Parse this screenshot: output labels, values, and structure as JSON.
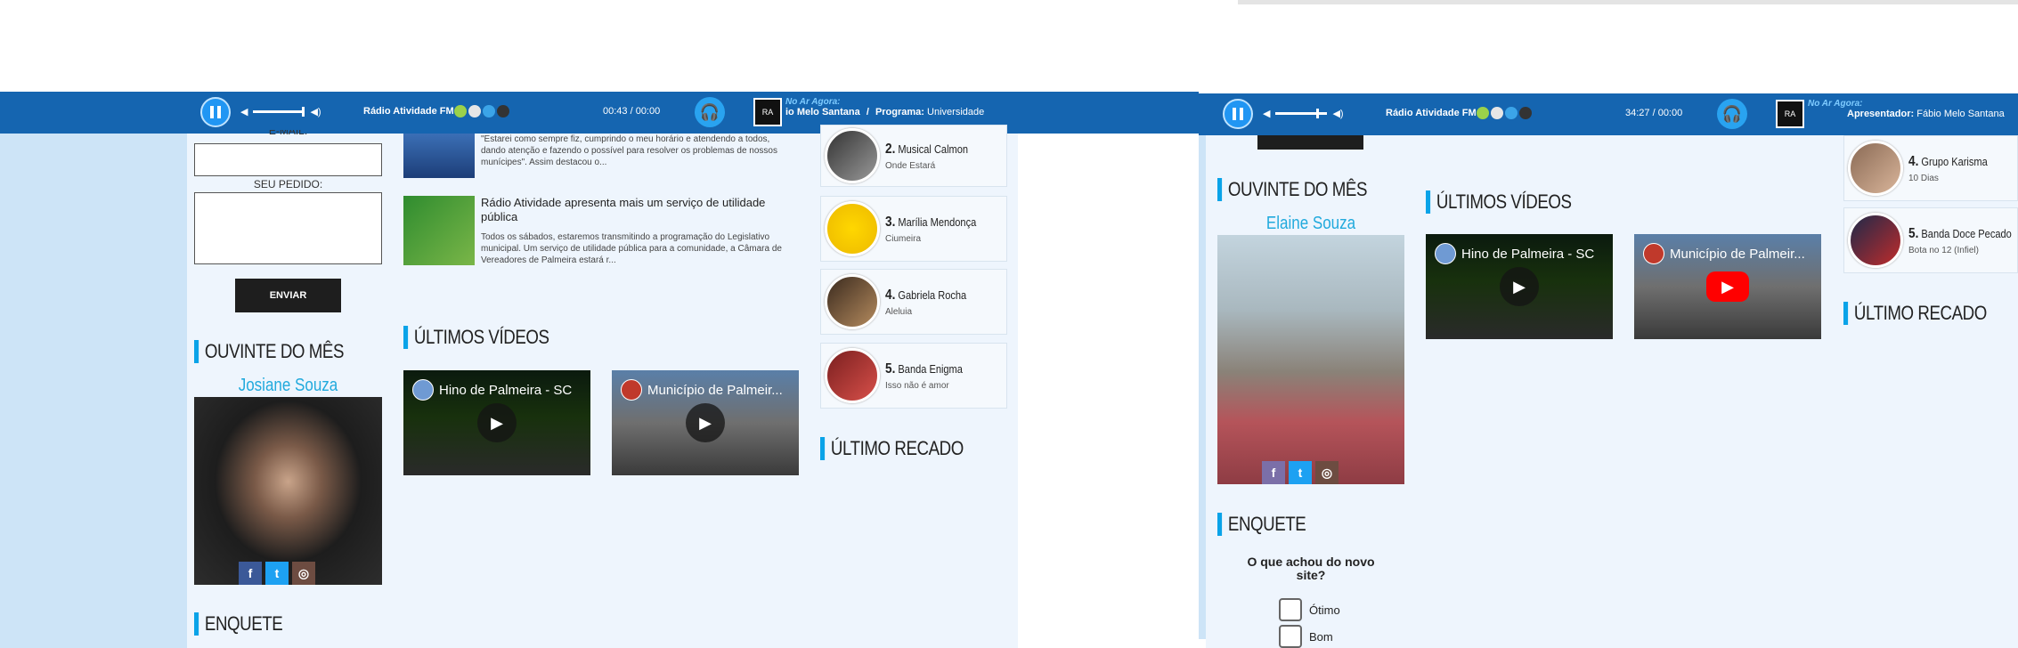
{
  "left": {
    "player": {
      "station": "Rádio Atividade FM",
      "time": "00:43 / 00:00",
      "now_on_air_label": "No Ar Agora:",
      "presenter_fragment": "io Melo Santana",
      "separator": "/",
      "program_label": "Programa:",
      "program_value": "Universidade"
    },
    "form": {
      "email_label": "E-MAIL:",
      "request_label": "SEU PEDIDO:",
      "send_button": "ENVIAR"
    },
    "listener": {
      "section_title": "OUVINTE DO MÊS",
      "name": "Josiane Souza"
    },
    "poll": {
      "section_title": "ENQUETE"
    },
    "news": [
      {
        "title": "",
        "text": "\"Estarei como sempre fiz, cumprindo o meu horário e atendendo a todos, dando atenção e fazendo o possível para resolver os problemas de nossos munícipes\". Assim destacou o..."
      },
      {
        "title": "Rádio Atividade apresenta mais um serviço de utilidade pública",
        "text": "Todos os sábados, estaremos transmitindo a programação do Legislativo municipal. Um serviço de utilidade pública para a comunidade, a Câmara de Vereadores de Palmeira estará r..."
      }
    ],
    "videos": {
      "section_title": "ÚLTIMOS VÍDEOS",
      "items": [
        "Hino de Palmeira - SC",
        "Município de Palmeir..."
      ]
    },
    "ranking": [
      {
        "pos": "2.",
        "artist": "Musical Calmon",
        "song": "Onde Estará"
      },
      {
        "pos": "3.",
        "artist": "Marília Mendonça",
        "song": "Ciumeira"
      },
      {
        "pos": "4.",
        "artist": "Gabriela Rocha",
        "song": "Aleluia"
      },
      {
        "pos": "5.",
        "artist": "Banda Enigma",
        "song": "Isso não é amor"
      }
    ],
    "messages": {
      "section_title": "ÚLTIMO RECADO"
    }
  },
  "right": {
    "player": {
      "station": "Rádio Atividade FM",
      "time": "34:27 / 00:00",
      "now_on_air_label": "No Ar Agora:",
      "presenter_label": "Apresentador:",
      "presenter_value": "Fábio Melo Santana"
    },
    "listener": {
      "section_title": "OUVINTE DO MÊS",
      "name": "Elaine Souza"
    },
    "videos": {
      "section_title": "ÚLTIMOS VÍDEOS",
      "items": [
        "Hino de Palmeira - SC",
        "Município de Palmeir..."
      ]
    },
    "ranking": [
      {
        "pos": "4.",
        "artist": "Grupo Karisma",
        "song": "10 Dias"
      },
      {
        "pos": "5.",
        "artist": "Banda Doce Pecado",
        "song": "Bota no 12 (Infiel)"
      }
    ],
    "messages": {
      "section_title": "ÚLTIMO RECADO"
    },
    "poll": {
      "section_title": "ENQUETE",
      "question": "O que achou do novo site?",
      "options": [
        "Ótimo",
        "Bom"
      ]
    }
  },
  "colors": {
    "bar": "#1565b0",
    "accent": "#0aa3e8",
    "listener_name": "#22aadd",
    "page_bg": "#cde4f7",
    "content_bg": "#eef5fd"
  },
  "icons": [
    "pause-icon",
    "volume-low-icon",
    "volume-high-icon",
    "android-icon",
    "apple-icon",
    "windows-icon",
    "blackberry-icon",
    "headphones-icon",
    "station-logo-icon",
    "facebook-icon",
    "twitter-icon",
    "instagram-icon",
    "play-icon"
  ]
}
